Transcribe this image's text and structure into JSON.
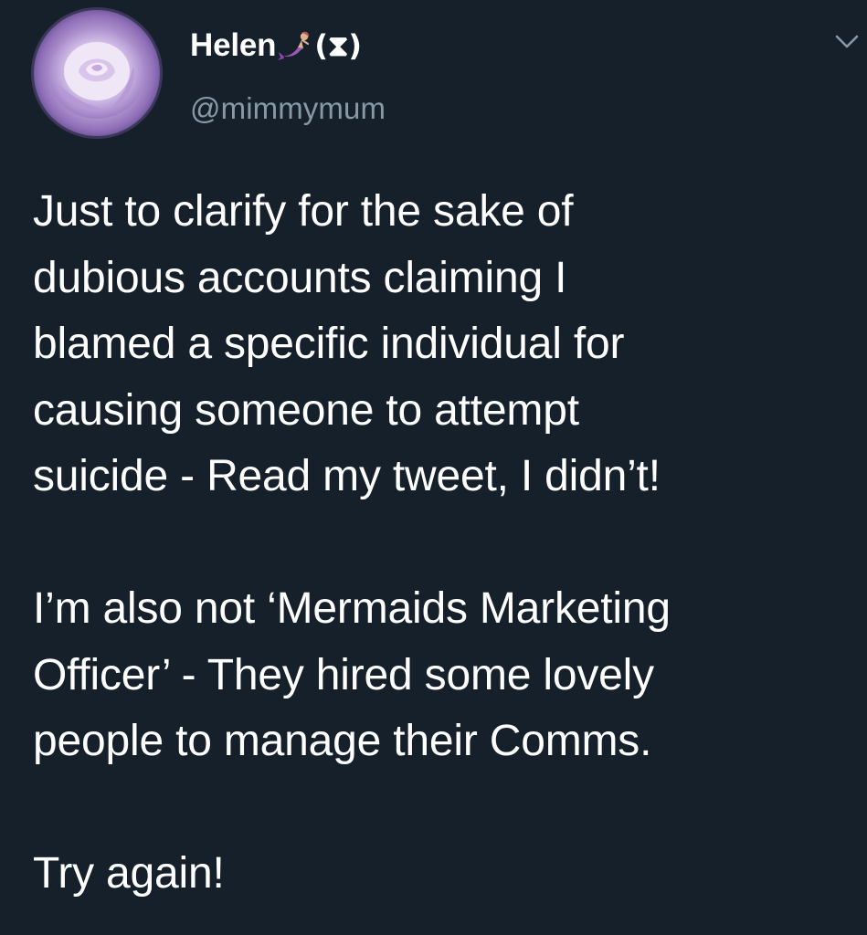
{
  "tweet": {
    "author": {
      "display_name": "Helen",
      "name_emoji": "mermaid-emoji",
      "name_suffix": "(⧗)",
      "handle": "@mimmymum",
      "avatar": "rose-avatar"
    },
    "menu_icon": "chevron-down-icon",
    "paragraphs": [
      "Just to clarify for the sake of\ndubious accounts claiming I\nblamed a specific individual for\ncausing someone to attempt\nsuicide - Read my tweet, I didn’t!",
      "I’m also not ‘Mermaids Marketing\nOfficer’ - They hired some lovely\npeople to manage their Comms.",
      "Try again!"
    ]
  },
  "colors": {
    "background": "#15202b",
    "text_primary": "#ffffff",
    "text_secondary": "#8899a6"
  }
}
